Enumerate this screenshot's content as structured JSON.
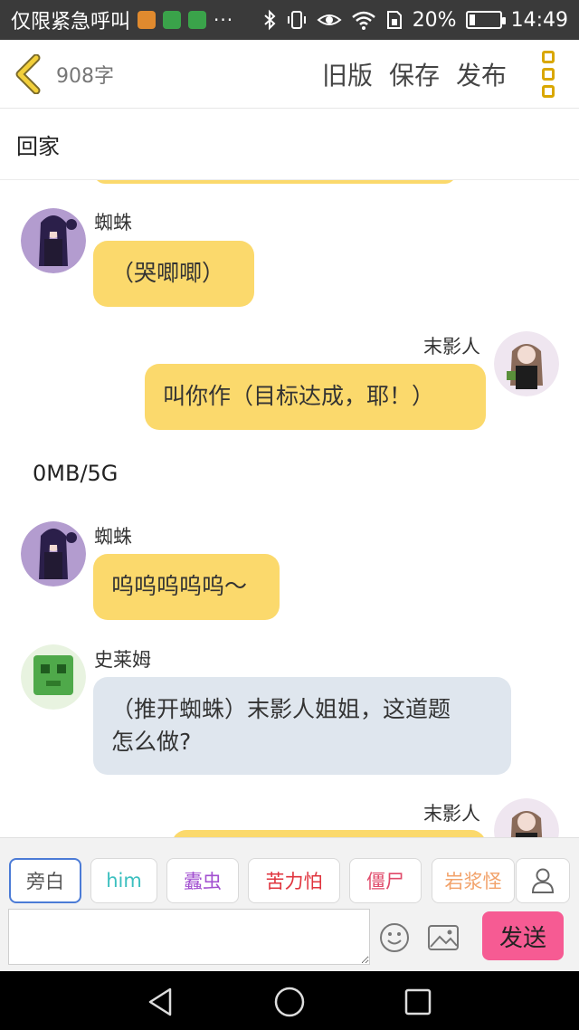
{
  "status_bar": {
    "left_text": "仅限紧急呼叫",
    "more": "···",
    "battery_percent_label": "20%",
    "battery_level": 0.2,
    "time": "14:49",
    "icons": [
      "app-icon-orange",
      "app-icon-green",
      "app-icon-green",
      "bluetooth-icon",
      "vibrate-icon",
      "eye-icon",
      "wifi-icon",
      "sim-icon",
      "battery-icon"
    ]
  },
  "header": {
    "word_count": "908字",
    "old_version": "旧版",
    "save": "保存",
    "publish": "发布",
    "back_icon": "chevron-left-icon",
    "menu_icon": "more-vertical-icon",
    "accent_color": "#d9a700"
  },
  "title": "回家",
  "messages": [
    {
      "kind": "chat",
      "side": "left",
      "sender": "蜘蛛",
      "text": "（哭唧唧）",
      "bubble": "yellow",
      "avatar": "spider"
    },
    {
      "kind": "chat",
      "side": "right",
      "sender": "末影人",
      "text": "叫你作（目标达成，耶！）",
      "bubble": "yellow",
      "avatar": "enderman"
    },
    {
      "kind": "narration",
      "text": "0MB/5G"
    },
    {
      "kind": "chat",
      "side": "left",
      "sender": "蜘蛛",
      "text": "呜呜呜呜呜～",
      "bubble": "yellow",
      "avatar": "spider"
    },
    {
      "kind": "chat",
      "side": "left",
      "sender": "史莱姆",
      "text_line1": "（推开蜘蛛）末影人姐姐，这道题",
      "text_line2": "怎么做?",
      "bubble": "gray",
      "avatar": "slime"
    },
    {
      "kind": "chat",
      "side": "right",
      "sender": "末影人",
      "text": "",
      "bubble": "yellow",
      "avatar": "enderman"
    }
  ],
  "characters": [
    {
      "label": "旁白",
      "color": "#555555",
      "selected": true
    },
    {
      "label": "him",
      "color": "#3bbfbf",
      "selected": false
    },
    {
      "label": "蠹虫",
      "color": "#a24fd0",
      "selected": false
    },
    {
      "label": "苦力怕",
      "color": "#e0343e",
      "selected": false
    },
    {
      "label": "僵尸",
      "color": "#e04a6a",
      "selected": false
    },
    {
      "label": "岩浆怪",
      "color": "#f2a26a",
      "selected": false
    }
  ],
  "composer": {
    "input_value": "",
    "input_placeholder": "",
    "send": "发送",
    "send_color": "#f65b93",
    "emoji_icon": "smiley-icon",
    "image_icon": "image-icon",
    "person_icon": "person-icon"
  },
  "nav": {
    "icons": [
      "back-triangle-icon",
      "home-circle-icon",
      "recents-square-icon"
    ]
  },
  "colors": {
    "bubble_yellow": "#fbd96c",
    "bubble_gray": "#dfe6ee"
  }
}
